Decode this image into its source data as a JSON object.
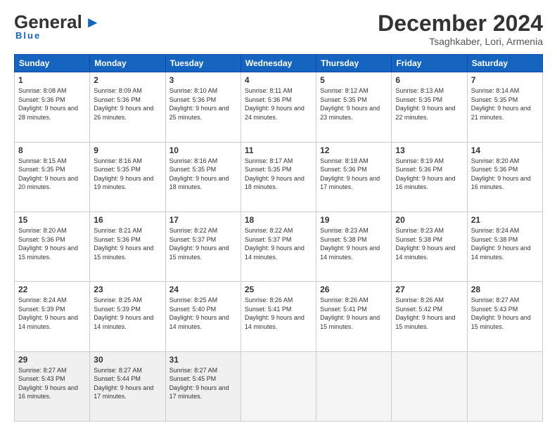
{
  "header": {
    "logo_general": "General",
    "logo_blue": "Blue",
    "month_title": "December 2024",
    "location": "Tsaghkaber, Lori, Armenia"
  },
  "days_of_week": [
    "Sunday",
    "Monday",
    "Tuesday",
    "Wednesday",
    "Thursday",
    "Friday",
    "Saturday"
  ],
  "weeks": [
    [
      {
        "day": "1",
        "sunrise": "Sunrise: 8:08 AM",
        "sunset": "Sunset: 5:36 PM",
        "daylight": "Daylight: 9 hours and 28 minutes."
      },
      {
        "day": "2",
        "sunrise": "Sunrise: 8:09 AM",
        "sunset": "Sunset: 5:36 PM",
        "daylight": "Daylight: 9 hours and 26 minutes."
      },
      {
        "day": "3",
        "sunrise": "Sunrise: 8:10 AM",
        "sunset": "Sunset: 5:36 PM",
        "daylight": "Daylight: 9 hours and 25 minutes."
      },
      {
        "day": "4",
        "sunrise": "Sunrise: 8:11 AM",
        "sunset": "Sunset: 5:36 PM",
        "daylight": "Daylight: 9 hours and 24 minutes."
      },
      {
        "day": "5",
        "sunrise": "Sunrise: 8:12 AM",
        "sunset": "Sunset: 5:35 PM",
        "daylight": "Daylight: 9 hours and 23 minutes."
      },
      {
        "day": "6",
        "sunrise": "Sunrise: 8:13 AM",
        "sunset": "Sunset: 5:35 PM",
        "daylight": "Daylight: 9 hours and 22 minutes."
      },
      {
        "day": "7",
        "sunrise": "Sunrise: 8:14 AM",
        "sunset": "Sunset: 5:35 PM",
        "daylight": "Daylight: 9 hours and 21 minutes."
      }
    ],
    [
      {
        "day": "8",
        "sunrise": "Sunrise: 8:15 AM",
        "sunset": "Sunset: 5:35 PM",
        "daylight": "Daylight: 9 hours and 20 minutes."
      },
      {
        "day": "9",
        "sunrise": "Sunrise: 8:16 AM",
        "sunset": "Sunset: 5:35 PM",
        "daylight": "Daylight: 9 hours and 19 minutes."
      },
      {
        "day": "10",
        "sunrise": "Sunrise: 8:16 AM",
        "sunset": "Sunset: 5:35 PM",
        "daylight": "Daylight: 9 hours and 18 minutes."
      },
      {
        "day": "11",
        "sunrise": "Sunrise: 8:17 AM",
        "sunset": "Sunset: 5:35 PM",
        "daylight": "Daylight: 9 hours and 18 minutes."
      },
      {
        "day": "12",
        "sunrise": "Sunrise: 8:18 AM",
        "sunset": "Sunset: 5:36 PM",
        "daylight": "Daylight: 9 hours and 17 minutes."
      },
      {
        "day": "13",
        "sunrise": "Sunrise: 8:19 AM",
        "sunset": "Sunset: 5:36 PM",
        "daylight": "Daylight: 9 hours and 16 minutes."
      },
      {
        "day": "14",
        "sunrise": "Sunrise: 8:20 AM",
        "sunset": "Sunset: 5:36 PM",
        "daylight": "Daylight: 9 hours and 16 minutes."
      }
    ],
    [
      {
        "day": "15",
        "sunrise": "Sunrise: 8:20 AM",
        "sunset": "Sunset: 5:36 PM",
        "daylight": "Daylight: 9 hours and 15 minutes."
      },
      {
        "day": "16",
        "sunrise": "Sunrise: 8:21 AM",
        "sunset": "Sunset: 5:36 PM",
        "daylight": "Daylight: 9 hours and 15 minutes."
      },
      {
        "day": "17",
        "sunrise": "Sunrise: 8:22 AM",
        "sunset": "Sunset: 5:37 PM",
        "daylight": "Daylight: 9 hours and 15 minutes."
      },
      {
        "day": "18",
        "sunrise": "Sunrise: 8:22 AM",
        "sunset": "Sunset: 5:37 PM",
        "daylight": "Daylight: 9 hours and 14 minutes."
      },
      {
        "day": "19",
        "sunrise": "Sunrise: 8:23 AM",
        "sunset": "Sunset: 5:38 PM",
        "daylight": "Daylight: 9 hours and 14 minutes."
      },
      {
        "day": "20",
        "sunrise": "Sunrise: 8:23 AM",
        "sunset": "Sunset: 5:38 PM",
        "daylight": "Daylight: 9 hours and 14 minutes."
      },
      {
        "day": "21",
        "sunrise": "Sunrise: 8:24 AM",
        "sunset": "Sunset: 5:38 PM",
        "daylight": "Daylight: 9 hours and 14 minutes."
      }
    ],
    [
      {
        "day": "22",
        "sunrise": "Sunrise: 8:24 AM",
        "sunset": "Sunset: 5:39 PM",
        "daylight": "Daylight: 9 hours and 14 minutes."
      },
      {
        "day": "23",
        "sunrise": "Sunrise: 8:25 AM",
        "sunset": "Sunset: 5:39 PM",
        "daylight": "Daylight: 9 hours and 14 minutes."
      },
      {
        "day": "24",
        "sunrise": "Sunrise: 8:25 AM",
        "sunset": "Sunset: 5:40 PM",
        "daylight": "Daylight: 9 hours and 14 minutes."
      },
      {
        "day": "25",
        "sunrise": "Sunrise: 8:26 AM",
        "sunset": "Sunset: 5:41 PM",
        "daylight": "Daylight: 9 hours and 14 minutes."
      },
      {
        "day": "26",
        "sunrise": "Sunrise: 8:26 AM",
        "sunset": "Sunset: 5:41 PM",
        "daylight": "Daylight: 9 hours and 15 minutes."
      },
      {
        "day": "27",
        "sunrise": "Sunrise: 8:26 AM",
        "sunset": "Sunset: 5:42 PM",
        "daylight": "Daylight: 9 hours and 15 minutes."
      },
      {
        "day": "28",
        "sunrise": "Sunrise: 8:27 AM",
        "sunset": "Sunset: 5:43 PM",
        "daylight": "Daylight: 9 hours and 15 minutes."
      }
    ],
    [
      {
        "day": "29",
        "sunrise": "Sunrise: 8:27 AM",
        "sunset": "Sunset: 5:43 PM",
        "daylight": "Daylight: 9 hours and 16 minutes."
      },
      {
        "day": "30",
        "sunrise": "Sunrise: 8:27 AM",
        "sunset": "Sunset: 5:44 PM",
        "daylight": "Daylight: 9 hours and 17 minutes."
      },
      {
        "day": "31",
        "sunrise": "Sunrise: 8:27 AM",
        "sunset": "Sunset: 5:45 PM",
        "daylight": "Daylight: 9 hours and 17 minutes."
      },
      null,
      null,
      null,
      null
    ]
  ]
}
